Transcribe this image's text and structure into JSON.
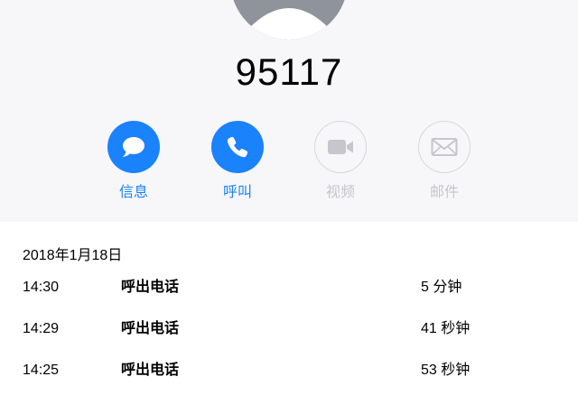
{
  "contact": {
    "number": "95117"
  },
  "actions": [
    {
      "label": "信息",
      "icon": "message-bubble-icon",
      "enabled": true
    },
    {
      "label": "呼叫",
      "icon": "phone-icon",
      "enabled": true
    },
    {
      "label": "视频",
      "icon": "video-camera-icon",
      "enabled": false
    },
    {
      "label": "邮件",
      "icon": "mail-envelope-icon",
      "enabled": false
    }
  ],
  "colors": {
    "accent": "#1a82fb",
    "disabled": "#c6c6cb",
    "header_bg": "#f7f7f9"
  },
  "history": {
    "date": "2018年1月18日",
    "calls": [
      {
        "time": "14:30",
        "type": "呼出电话",
        "duration": "5 分钟"
      },
      {
        "time": "14:29",
        "type": "呼出电话",
        "duration": "41 秒钟"
      },
      {
        "time": "14:25",
        "type": "呼出电话",
        "duration": "53 秒钟"
      }
    ]
  }
}
